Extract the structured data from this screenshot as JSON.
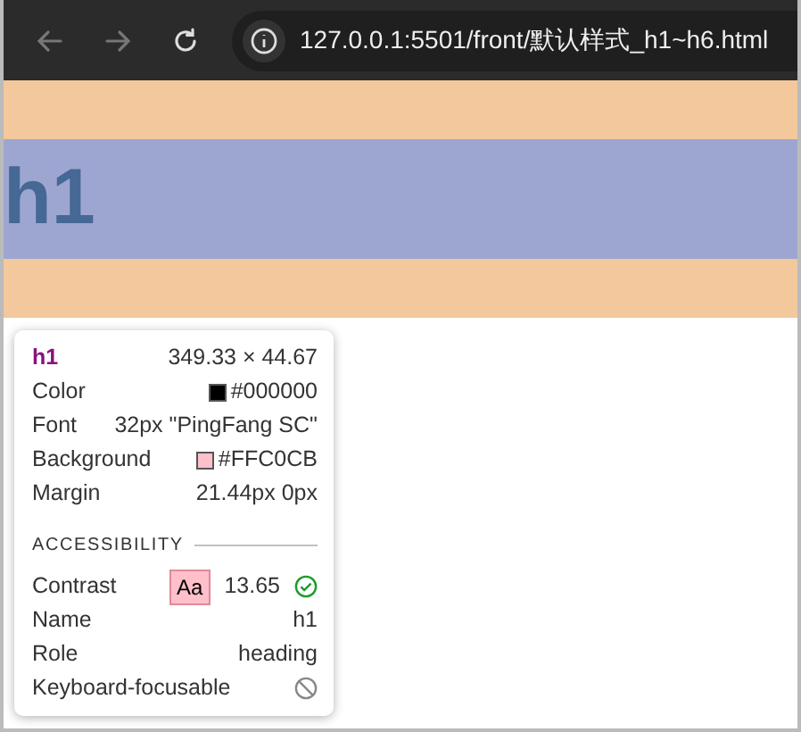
{
  "browser": {
    "url": "127.0.0.1:5501/front/默认样式_h1~h6.html",
    "back_disabled": true,
    "forward_disabled": true
  },
  "page": {
    "heading": "h1"
  },
  "inspector": {
    "tag": "h1",
    "size": "349.33 × 44.67",
    "rows": [
      {
        "kind": "swatch",
        "label": "Color",
        "value": "#000000",
        "color": "#000000"
      },
      {
        "kind": "text",
        "label": "Font",
        "value": "32px \"PingFang SC\""
      },
      {
        "kind": "swatch",
        "label": "Background",
        "value": "#FFC0CB",
        "color": "#ffc0cb"
      },
      {
        "kind": "text",
        "label": "Margin",
        "value": "21.44px 0px"
      }
    ],
    "section": "ACCESSIBILITY",
    "accessibility": [
      {
        "kind": "contrast",
        "label": "Contrast",
        "sample": "Aa",
        "value": "13.65",
        "passed": true
      },
      {
        "kind": "text",
        "label": "Name",
        "value": "h1"
      },
      {
        "kind": "text",
        "label": "Role",
        "value": "heading"
      },
      {
        "kind": "focus",
        "label": "Keyboard-focusable",
        "focusable": false
      }
    ]
  }
}
